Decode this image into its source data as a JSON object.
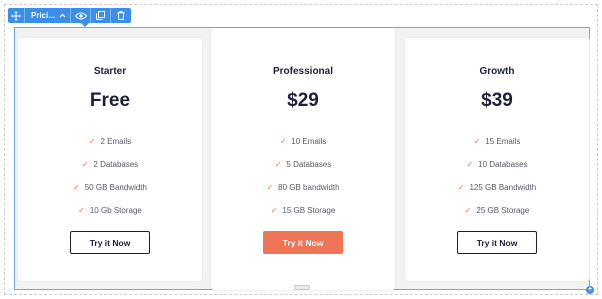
{
  "toolbar": {
    "label": "Prici..."
  },
  "plans": [
    {
      "name": "Starter",
      "price": "Free",
      "features": [
        "2 Emails",
        "2 Databases",
        "50 GB Bandwidth",
        "10 Gb Storage"
      ],
      "cta": "Try it Now",
      "cta_style": "outline"
    },
    {
      "name": "Professional",
      "price": "$29",
      "features": [
        "10 Emails",
        "5 Databases",
        "80 GB bandwidth",
        "15 GB Storage"
      ],
      "cta": "Try it Now",
      "cta_style": "solid"
    },
    {
      "name": "Growth",
      "price": "$39",
      "features": [
        "15 Emails",
        "10 Databases",
        "125 GB Bandwidth",
        "25 GB Storage"
      ],
      "cta": "Try it Now",
      "cta_style": "outline"
    }
  ],
  "colors": {
    "accent": "#f07456",
    "editor_blue": "#3b8eea",
    "heading": "#1c1f3a"
  }
}
